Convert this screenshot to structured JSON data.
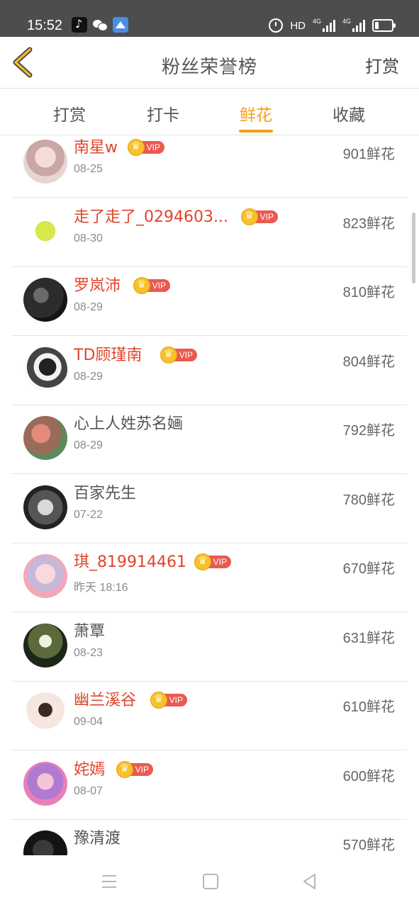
{
  "status_bar": {
    "time": "15:52",
    "apps": [
      "tiktok-icon",
      "wechat-icon",
      "navigation-icon"
    ],
    "hd": "HD",
    "net1": "4G",
    "net2": "4G"
  },
  "header": {
    "title": "粉丝荣誉榜",
    "action": "打赏",
    "back_icon": "chevron-left-icon",
    "accent": "#f3a019"
  },
  "tabs": [
    {
      "label": "打赏",
      "active": false
    },
    {
      "label": "打卡",
      "active": false
    },
    {
      "label": "鲜花",
      "active": true
    },
    {
      "label": "收藏",
      "active": false
    }
  ],
  "vip_label": "VIP",
  "unit": "鲜花",
  "fans": [
    {
      "name": "南星w",
      "date": "08-25",
      "count": "901",
      "vip": true
    },
    {
      "name": "走了走了_0294603...",
      "date": "08-30",
      "count": "823",
      "vip": true
    },
    {
      "name": "罗岚沛",
      "date": "08-29",
      "count": "810",
      "vip": true
    },
    {
      "name": "TD顾瑾南",
      "date": "08-29",
      "count": "804",
      "vip": true
    },
    {
      "name": "心上人姓苏名婳",
      "date": "08-29",
      "count": "792",
      "vip": false
    },
    {
      "name": "百家先生",
      "date": "07-22",
      "count": "780",
      "vip": false
    },
    {
      "name": "琪_819914461",
      "date": "昨天 18:16",
      "count": "670",
      "vip": true
    },
    {
      "name": "萧覃",
      "date": "08-23",
      "count": "631",
      "vip": false
    },
    {
      "name": "幽兰溪谷",
      "date": "09-04",
      "count": "610",
      "vip": true
    },
    {
      "name": "姹嫣",
      "date": "08-07",
      "count": "600",
      "vip": true
    },
    {
      "name": "豫清渡",
      "date": "",
      "count": "570",
      "vip": false
    }
  ]
}
